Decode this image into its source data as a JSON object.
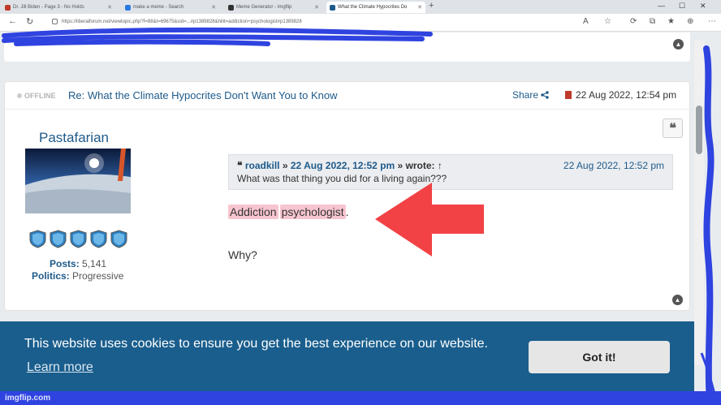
{
  "browser": {
    "tabs": [
      {
        "title": "Dr. Jill Biden - Page 3 - No Holds",
        "fav_color": "#c0392b"
      },
      {
        "title": "make a meme - Search",
        "fav_color": "#2a7ae2"
      },
      {
        "title": "Meme Generator - Imgflip",
        "fav_color": "#333333"
      },
      {
        "title": "What the Climate Hypocrites Do",
        "fav_color": "#1e5a8a",
        "active": true
      }
    ],
    "url": "https://liberalforum.net/viewtopic.php?f=88&t=69675&sid=...#p1389828&hilit=addiction+psychologist#p1389828"
  },
  "post": {
    "status": "OFFLINE",
    "title": "Re: What the Climate Hypocrites Don't Want You to Know",
    "share_label": "Share",
    "date": "22 Aug 2022, 12:54 pm",
    "quote_button_glyph": "❝",
    "author": {
      "username": "Pastafarian",
      "rank_count": 5,
      "posts_label": "Posts:",
      "posts_value": "5,141",
      "politics_label": "Politics:",
      "politics_value": "Progressive"
    },
    "quote": {
      "quote_glyph": "❝",
      "author": "roadkill",
      "date": "22 Aug 2022, 12:52 pm",
      "wrote": "» wrote: ↑",
      "separator": "»",
      "right_date": "22 Aug 2022, 12:52 pm",
      "text": "What was that thing you did for a living again???"
    },
    "reply": {
      "word1": "Addiction",
      "word2": "psychologist",
      "punct": ".",
      "line2": "Why?"
    }
  },
  "cookie_banner": {
    "message": "This website uses cookies to ensure you get the best experience on our website.",
    "learn_more": "Learn more",
    "button": "Got it!"
  },
  "watermark": "imgflip.com",
  "colors": {
    "link": "#1e5a8a",
    "banner": "#1a5e8d",
    "highlight": "#f7c5cf",
    "arrow": "#f24245",
    "marker": "#2f43e0"
  }
}
